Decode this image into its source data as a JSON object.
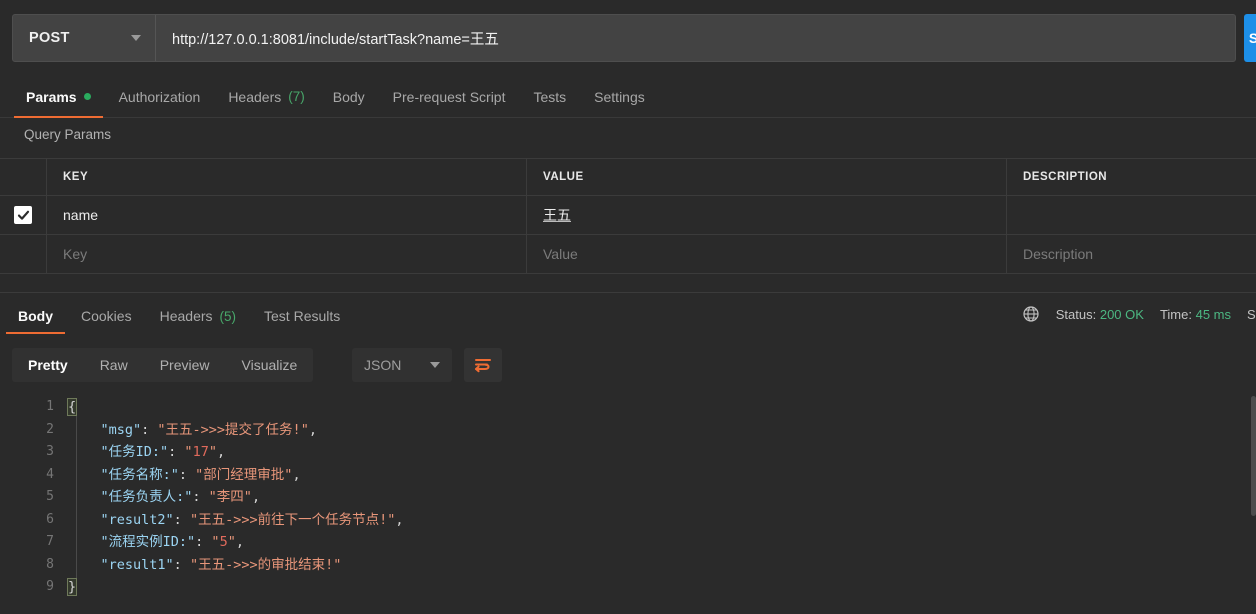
{
  "request": {
    "method": "POST",
    "url": "http://127.0.0.1:8081/include/startTask?name=王五",
    "send_label": "Send",
    "tabs": [
      {
        "label": "Params",
        "badge": "",
        "dot": true,
        "active": true
      },
      {
        "label": "Authorization",
        "badge": "",
        "dot": false,
        "active": false
      },
      {
        "label": "Headers",
        "badge": "(7)",
        "dot": false,
        "active": false
      },
      {
        "label": "Body",
        "badge": "",
        "dot": false,
        "active": false
      },
      {
        "label": "Pre-request Script",
        "badge": "",
        "dot": false,
        "active": false
      },
      {
        "label": "Tests",
        "badge": "",
        "dot": false,
        "active": false
      },
      {
        "label": "Settings",
        "badge": "",
        "dot": false,
        "active": false
      }
    ]
  },
  "query_params": {
    "title": "Query Params",
    "columns": [
      "KEY",
      "VALUE",
      "DESCRIPTION"
    ],
    "rows": [
      {
        "checked": true,
        "key": "name",
        "value": "王五",
        "description": ""
      }
    ],
    "placeholder_row": {
      "key": "Key",
      "value": "Value",
      "description": "Description"
    }
  },
  "response": {
    "tabs": [
      {
        "label": "Body",
        "badge": "",
        "active": true
      },
      {
        "label": "Cookies",
        "badge": "",
        "active": false
      },
      {
        "label": "Headers",
        "badge": "(5)",
        "active": false
      },
      {
        "label": "Test Results",
        "badge": "",
        "active": false
      }
    ],
    "meta": {
      "status_label": "Status:",
      "status_value": "200 OK",
      "time_label": "Time:",
      "time_value": "45 ms",
      "size_label_cut": "S"
    },
    "format_tabs": [
      {
        "label": "Pretty",
        "active": true
      },
      {
        "label": "Raw",
        "active": false
      },
      {
        "label": "Preview",
        "active": false
      },
      {
        "label": "Visualize",
        "active": false
      }
    ],
    "language": "JSON",
    "body_lines": [
      {
        "n": "1",
        "tokens": [
          {
            "t": "brace",
            "s": "{"
          }
        ]
      },
      {
        "n": "2",
        "tokens": [
          {
            "t": "plain",
            "s": "    "
          },
          {
            "t": "key",
            "s": "\"msg\""
          },
          {
            "t": "punc",
            "s": ": "
          },
          {
            "t": "str",
            "s": "\"王五->>>提交了任务!\""
          },
          {
            "t": "punc",
            "s": ","
          }
        ]
      },
      {
        "n": "3",
        "tokens": [
          {
            "t": "plain",
            "s": "    "
          },
          {
            "t": "key",
            "s": "\"任务ID:\""
          },
          {
            "t": "punc",
            "s": ": "
          },
          {
            "t": "str",
            "s": "\""
          },
          {
            "t": "num",
            "s": "17"
          },
          {
            "t": "str",
            "s": "\""
          },
          {
            "t": "punc",
            "s": ","
          }
        ]
      },
      {
        "n": "4",
        "tokens": [
          {
            "t": "plain",
            "s": "    "
          },
          {
            "t": "key",
            "s": "\"任务名称:\""
          },
          {
            "t": "punc",
            "s": ": "
          },
          {
            "t": "str",
            "s": "\"部门经理审批\""
          },
          {
            "t": "punc",
            "s": ","
          }
        ]
      },
      {
        "n": "5",
        "tokens": [
          {
            "t": "plain",
            "s": "    "
          },
          {
            "t": "key",
            "s": "\"任务负责人:\""
          },
          {
            "t": "punc",
            "s": ": "
          },
          {
            "t": "str",
            "s": "\"李四\""
          },
          {
            "t": "punc",
            "s": ","
          }
        ]
      },
      {
        "n": "6",
        "tokens": [
          {
            "t": "plain",
            "s": "    "
          },
          {
            "t": "key",
            "s": "\"result2\""
          },
          {
            "t": "punc",
            "s": ": "
          },
          {
            "t": "str",
            "s": "\"王五->>>前往下一个任务节点!\""
          },
          {
            "t": "punc",
            "s": ","
          }
        ]
      },
      {
        "n": "7",
        "tokens": [
          {
            "t": "plain",
            "s": "    "
          },
          {
            "t": "key",
            "s": "\"流程实例ID:\""
          },
          {
            "t": "punc",
            "s": ": "
          },
          {
            "t": "str",
            "s": "\""
          },
          {
            "t": "num",
            "s": "5"
          },
          {
            "t": "str",
            "s": "\""
          },
          {
            "t": "punc",
            "s": ","
          }
        ]
      },
      {
        "n": "8",
        "tokens": [
          {
            "t": "plain",
            "s": "    "
          },
          {
            "t": "key",
            "s": "\"result1\""
          },
          {
            "t": "punc",
            "s": ": "
          },
          {
            "t": "str",
            "s": "\"王五->>>的审批结束!\""
          }
        ]
      },
      {
        "n": "9",
        "tokens": [
          {
            "t": "brace",
            "s": "}"
          }
        ]
      }
    ]
  },
  "colors": {
    "accent_orange": "#ef6c33",
    "send_blue": "#1d8fe8",
    "status_green": "#4cb782",
    "json_key": "#9bd4f2",
    "json_string": "#e8967a",
    "json_number": "#e06a5c"
  }
}
